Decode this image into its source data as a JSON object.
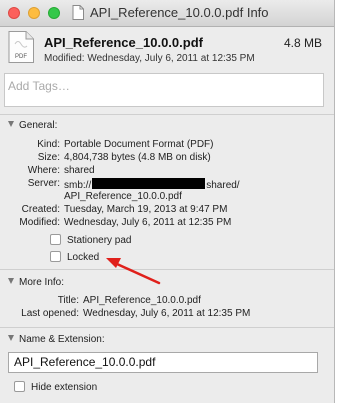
{
  "window": {
    "title": "API_Reference_10.0.0.pdf Info"
  },
  "header": {
    "file_name": "API_Reference_10.0.0.pdf",
    "file_size": "4.8 MB",
    "modified": "Modified: Wednesday, July 6, 2011 at 12:35 PM",
    "pdf_label": "PDF"
  },
  "tags": {
    "placeholder": "Add Tags…"
  },
  "general": {
    "heading": "General:",
    "kind_label": "Kind:",
    "kind_value": "Portable Document Format (PDF)",
    "size_label": "Size:",
    "size_value": "4,804,738 bytes (4.8 MB on disk)",
    "where_label": "Where:",
    "where_value": "shared",
    "server_label": "Server:",
    "server_prefix": "smb://",
    "server_suffix": "shared/",
    "server_line2": "API_Reference_10.0.0.pdf",
    "created_label": "Created:",
    "created_value": "Tuesday, March 19, 2013 at 9:47 PM",
    "modified_label": "Modified:",
    "modified_value": "Wednesday, July 6, 2011 at 12:35 PM",
    "stationery_label": "Stationery pad",
    "locked_label": "Locked"
  },
  "more_info": {
    "heading": "More Info:",
    "title_label": "Title:",
    "title_value": "API_Reference_10.0.0.pdf",
    "last_opened_label": "Last opened:",
    "last_opened_value": "Wednesday, July 6, 2011 at 12:35 PM"
  },
  "name_extension": {
    "heading": "Name & Extension:",
    "name_value": "API_Reference_10.0.0.pdf",
    "hide_extension_label": "Hide extension"
  },
  "colors": {
    "arrow": "#e0201b",
    "close": "#fc605c",
    "minimize": "#fdbc40",
    "zoom": "#34c84a"
  },
  "checkboxes": {
    "stationery_pad": false,
    "locked": false,
    "hide_extension": false
  }
}
